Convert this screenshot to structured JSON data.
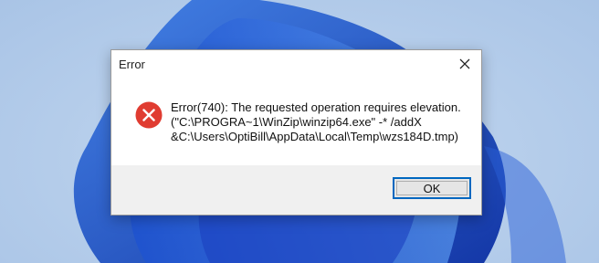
{
  "dialog": {
    "title": "Error",
    "message_lines": [
      "Error(740): The requested operation requires elevation.",
      " (\"C:\\PROGRA~1\\WinZip\\winzip64.exe\" -* /addX",
      "&C:\\Users\\OptiBill\\AppData\\Local\\Temp\\wzs184D.tmp)"
    ],
    "ok_label": "OK",
    "icon": "error-icon",
    "close_icon": "close-icon"
  },
  "colors": {
    "error_red": "#e03c31",
    "accent_blue": "#0067c0",
    "footer_bg": "#f0f0f0"
  }
}
